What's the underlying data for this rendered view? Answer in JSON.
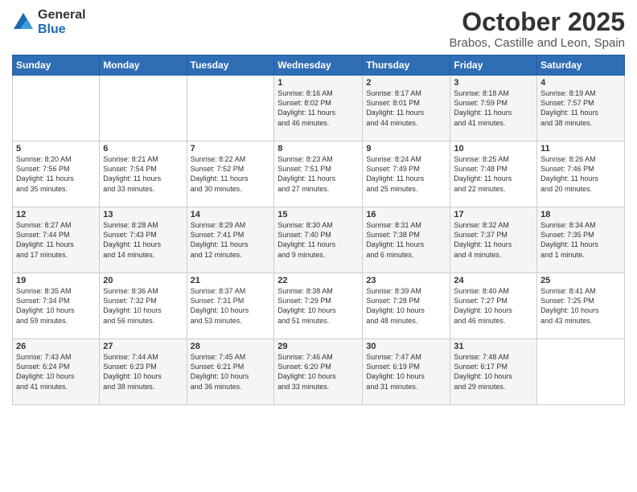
{
  "logo": {
    "general": "General",
    "blue": "Blue"
  },
  "title": {
    "month": "October 2025",
    "location": "Brabos, Castille and Leon, Spain"
  },
  "weekdays": [
    "Sunday",
    "Monday",
    "Tuesday",
    "Wednesday",
    "Thursday",
    "Friday",
    "Saturday"
  ],
  "weeks": [
    [
      {
        "day": "",
        "info": ""
      },
      {
        "day": "",
        "info": ""
      },
      {
        "day": "",
        "info": ""
      },
      {
        "day": "1",
        "info": "Sunrise: 8:16 AM\nSunset: 8:02 PM\nDaylight: 11 hours\nand 46 minutes."
      },
      {
        "day": "2",
        "info": "Sunrise: 8:17 AM\nSunset: 8:01 PM\nDaylight: 11 hours\nand 44 minutes."
      },
      {
        "day": "3",
        "info": "Sunrise: 8:18 AM\nSunset: 7:59 PM\nDaylight: 11 hours\nand 41 minutes."
      },
      {
        "day": "4",
        "info": "Sunrise: 8:19 AM\nSunset: 7:57 PM\nDaylight: 11 hours\nand 38 minutes."
      }
    ],
    [
      {
        "day": "5",
        "info": "Sunrise: 8:20 AM\nSunset: 7:56 PM\nDaylight: 11 hours\nand 35 minutes."
      },
      {
        "day": "6",
        "info": "Sunrise: 8:21 AM\nSunset: 7:54 PM\nDaylight: 11 hours\nand 33 minutes."
      },
      {
        "day": "7",
        "info": "Sunrise: 8:22 AM\nSunset: 7:52 PM\nDaylight: 11 hours\nand 30 minutes."
      },
      {
        "day": "8",
        "info": "Sunrise: 8:23 AM\nSunset: 7:51 PM\nDaylight: 11 hours\nand 27 minutes."
      },
      {
        "day": "9",
        "info": "Sunrise: 8:24 AM\nSunset: 7:49 PM\nDaylight: 11 hours\nand 25 minutes."
      },
      {
        "day": "10",
        "info": "Sunrise: 8:25 AM\nSunset: 7:48 PM\nDaylight: 11 hours\nand 22 minutes."
      },
      {
        "day": "11",
        "info": "Sunrise: 8:26 AM\nSunset: 7:46 PM\nDaylight: 11 hours\nand 20 minutes."
      }
    ],
    [
      {
        "day": "12",
        "info": "Sunrise: 8:27 AM\nSunset: 7:44 PM\nDaylight: 11 hours\nand 17 minutes."
      },
      {
        "day": "13",
        "info": "Sunrise: 8:28 AM\nSunset: 7:43 PM\nDaylight: 11 hours\nand 14 minutes."
      },
      {
        "day": "14",
        "info": "Sunrise: 8:29 AM\nSunset: 7:41 PM\nDaylight: 11 hours\nand 12 minutes."
      },
      {
        "day": "15",
        "info": "Sunrise: 8:30 AM\nSunset: 7:40 PM\nDaylight: 11 hours\nand 9 minutes."
      },
      {
        "day": "16",
        "info": "Sunrise: 8:31 AM\nSunset: 7:38 PM\nDaylight: 11 hours\nand 6 minutes."
      },
      {
        "day": "17",
        "info": "Sunrise: 8:32 AM\nSunset: 7:37 PM\nDaylight: 11 hours\nand 4 minutes."
      },
      {
        "day": "18",
        "info": "Sunrise: 8:34 AM\nSunset: 7:35 PM\nDaylight: 11 hours\nand 1 minute."
      }
    ],
    [
      {
        "day": "19",
        "info": "Sunrise: 8:35 AM\nSunset: 7:34 PM\nDaylight: 10 hours\nand 59 minutes."
      },
      {
        "day": "20",
        "info": "Sunrise: 8:36 AM\nSunset: 7:32 PM\nDaylight: 10 hours\nand 56 minutes."
      },
      {
        "day": "21",
        "info": "Sunrise: 8:37 AM\nSunset: 7:31 PM\nDaylight: 10 hours\nand 53 minutes."
      },
      {
        "day": "22",
        "info": "Sunrise: 8:38 AM\nSunset: 7:29 PM\nDaylight: 10 hours\nand 51 minutes."
      },
      {
        "day": "23",
        "info": "Sunrise: 8:39 AM\nSunset: 7:28 PM\nDaylight: 10 hours\nand 48 minutes."
      },
      {
        "day": "24",
        "info": "Sunrise: 8:40 AM\nSunset: 7:27 PM\nDaylight: 10 hours\nand 46 minutes."
      },
      {
        "day": "25",
        "info": "Sunrise: 8:41 AM\nSunset: 7:25 PM\nDaylight: 10 hours\nand 43 minutes."
      }
    ],
    [
      {
        "day": "26",
        "info": "Sunrise: 7:43 AM\nSunset: 6:24 PM\nDaylight: 10 hours\nand 41 minutes."
      },
      {
        "day": "27",
        "info": "Sunrise: 7:44 AM\nSunset: 6:23 PM\nDaylight: 10 hours\nand 38 minutes."
      },
      {
        "day": "28",
        "info": "Sunrise: 7:45 AM\nSunset: 6:21 PM\nDaylight: 10 hours\nand 36 minutes."
      },
      {
        "day": "29",
        "info": "Sunrise: 7:46 AM\nSunset: 6:20 PM\nDaylight: 10 hours\nand 33 minutes."
      },
      {
        "day": "30",
        "info": "Sunrise: 7:47 AM\nSunset: 6:19 PM\nDaylight: 10 hours\nand 31 minutes."
      },
      {
        "day": "31",
        "info": "Sunrise: 7:48 AM\nSunset: 6:17 PM\nDaylight: 10 hours\nand 29 minutes."
      },
      {
        "day": "",
        "info": ""
      }
    ]
  ]
}
